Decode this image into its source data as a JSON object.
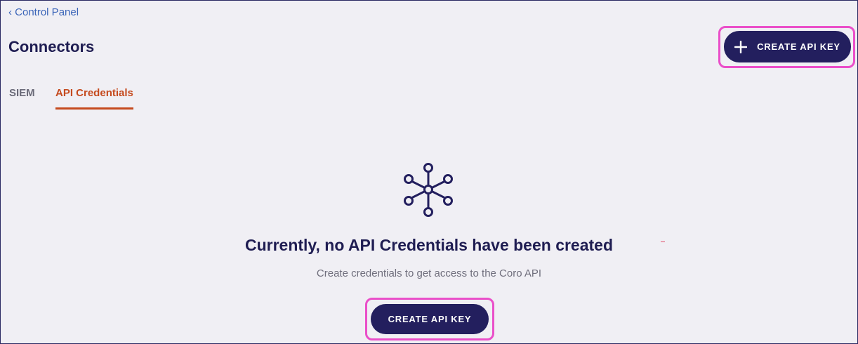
{
  "header": {
    "breadcrumb": "‹ Control Panel",
    "title": "Connectors",
    "create_button_label": "CREATE API KEY"
  },
  "tabs": [
    {
      "label": "SIEM",
      "active": false
    },
    {
      "label": "API Credentials",
      "active": true
    }
  ],
  "empty_state": {
    "icon": "network-hub-icon",
    "title": "Currently, no API Credentials have been created",
    "subtitle": "Create credentials to get access to the Coro API",
    "button_label": "CREATE API KEY"
  },
  "colors": {
    "background": "#f0eff4",
    "primary": "#231f5e",
    "active_tab": "#c54a1e",
    "link": "#3a64b8",
    "highlight": "#ea4fc9"
  }
}
